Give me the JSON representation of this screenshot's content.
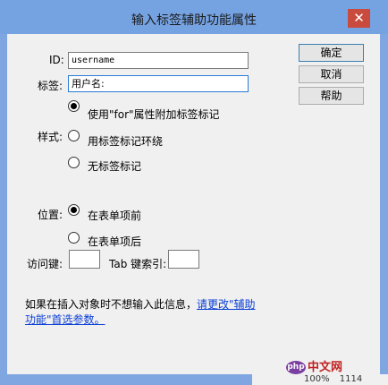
{
  "window": {
    "title": "输入标签辅助功能属性",
    "close_glyph": "✕"
  },
  "form": {
    "id_label": "ID:",
    "id_value": "username",
    "label_label": "标签:",
    "label_value": "用户名:",
    "style_label": "样式:",
    "style_options": [
      {
        "label": "使用\"for\"属性附加标签标记",
        "checked": true
      },
      {
        "label": "用标签标记环绕",
        "checked": false
      },
      {
        "label": "无标签标记",
        "checked": false
      }
    ],
    "position_label": "位置:",
    "position_options": [
      {
        "label": "在表单项前",
        "checked": true
      },
      {
        "label": "在表单项后",
        "checked": false
      }
    ],
    "accesskey_label": "访问键:",
    "accesskey_value": "",
    "tabindex_label": "Tab 键索引:",
    "tabindex_value": ""
  },
  "buttons": {
    "ok": "确定",
    "cancel": "取消",
    "help": "帮助"
  },
  "info": {
    "text": "如果在插入对象时不想输入此信息，",
    "link": "请更改\"辅助功能\"首选参数。"
  },
  "watermark": {
    "logo": "php",
    "text": "中文网"
  },
  "statusbar": {
    "zoom": "100%",
    "size": "1114"
  }
}
